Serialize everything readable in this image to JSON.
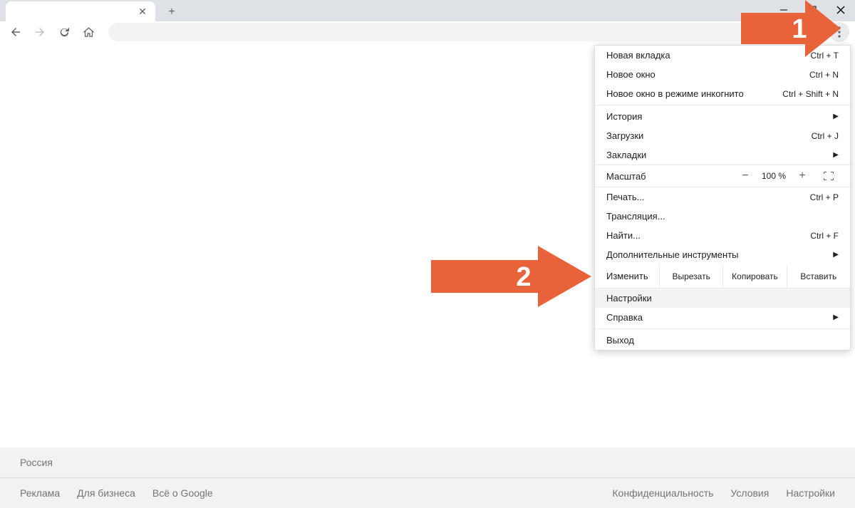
{
  "window_controls": {
    "minimize": "−",
    "maximize": "❐",
    "close": "✕"
  },
  "nav": {
    "back": "←",
    "forward": "→",
    "reload": "↻",
    "home": "⌂"
  },
  "menu": {
    "new_tab": {
      "label": "Новая вкладка",
      "shortcut": "Ctrl + T"
    },
    "new_window": {
      "label": "Новое окно",
      "shortcut": "Ctrl + N"
    },
    "incognito": {
      "label": "Новое окно в режиме инкогнито",
      "shortcut": "Ctrl + Shift + N"
    },
    "history": {
      "label": "История"
    },
    "downloads": {
      "label": "Загрузки",
      "shortcut": "Ctrl + J"
    },
    "bookmarks": {
      "label": "Закладки"
    },
    "zoom": {
      "label": "Масштаб",
      "value": "100 %",
      "minus": "−",
      "plus": "+"
    },
    "print": {
      "label": "Печать...",
      "shortcut": "Ctrl + P"
    },
    "cast": {
      "label": "Трансляция..."
    },
    "find": {
      "label": "Найти...",
      "shortcut": "Ctrl + F"
    },
    "more_tools": {
      "label": "Дополнительные инструменты"
    },
    "edit_row": {
      "label": "Изменить",
      "cut": "Вырезать",
      "copy": "Копировать",
      "paste": "Вставить"
    },
    "settings": {
      "label": "Настройки"
    },
    "help": {
      "label": "Справка"
    },
    "exit": {
      "label": "Выход"
    }
  },
  "footer": {
    "country": "Россия",
    "left": {
      "ads": "Реклама",
      "business": "Для бизнеса",
      "about": "Всё о Google"
    },
    "right": {
      "privacy": "Конфиденциальность",
      "terms": "Условия",
      "settings": "Настройки"
    }
  },
  "annotations": {
    "arrow1": "1",
    "arrow2": "2"
  }
}
